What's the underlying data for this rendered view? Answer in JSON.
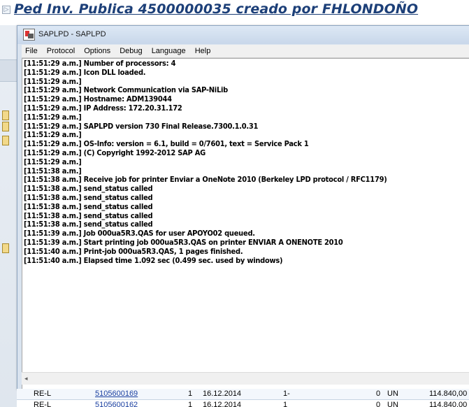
{
  "background": {
    "title": "Ped Inv. Publica 4500000035 creado por FHLONDOÑO",
    "table_rows": [
      {
        "type": "RE-L",
        "document": "5105600169",
        "qty": "1",
        "date": "16.12.2014",
        "d": "1-",
        "z": "0",
        "unit": "UN",
        "amount": "114.840,00"
      },
      {
        "type": "RE-L",
        "document": "5105600162",
        "qty": "1",
        "date": "16.12.2014",
        "d": "1",
        "z": "0",
        "unit": "UN",
        "amount": "114.840,00"
      }
    ]
  },
  "window": {
    "title": "SAPLPD - SAPLPD",
    "menu": [
      "File",
      "Protocol",
      "Options",
      "Debug",
      "Language",
      "Help"
    ],
    "log": [
      "[11:51:29 a.m.] Number of processors: 4",
      "[11:51:29 a.m.] Icon DLL loaded.",
      "[11:51:29 a.m.]",
      "[11:51:29 a.m.] Network Communication via SAP-NiLib",
      "[11:51:29 a.m.] Hostname: ADM139044",
      "[11:51:29 a.m.] IP Address: 172.20.31.172",
      "[11:51:29 a.m.]",
      "[11:51:29 a.m.] SAPLPD version 730 Final Release.7300.1.0.31",
      "[11:51:29 a.m.]",
      "[11:51:29 a.m.] OS-Info: version = 6.1, build = 0/7601, text = Service Pack 1",
      "[11:51:29 a.m.] (C) Copyright 1992-2012 SAP AG",
      "[11:51:29 a.m.]",
      "[11:51:38 a.m.]",
      "[11:51:38 a.m.] Receive job for printer Enviar a OneNote 2010 (Berkeley LPD protocol / RFC1179)",
      "[11:51:38 a.m.] send_status called",
      "[11:51:38 a.m.] send_status called",
      "[11:51:38 a.m.] send_status called",
      "[11:51:38 a.m.] send_status called",
      "[11:51:38 a.m.] send_status called",
      "[11:51:39 a.m.] Job 000ua5R3.QAS for user APOYO02 queued.",
      "[11:51:39 a.m.] Start printing job 000ua5R3.QAS on printer ENVIAR A ONENOTE 2010",
      "[11:51:40 a.m.] Print-job 000ua5R3.QAS, 1 pages finished.",
      "[11:51:40 a.m.] Elapsed time 1.092 sec (0.499 sec. used by windows)"
    ]
  }
}
